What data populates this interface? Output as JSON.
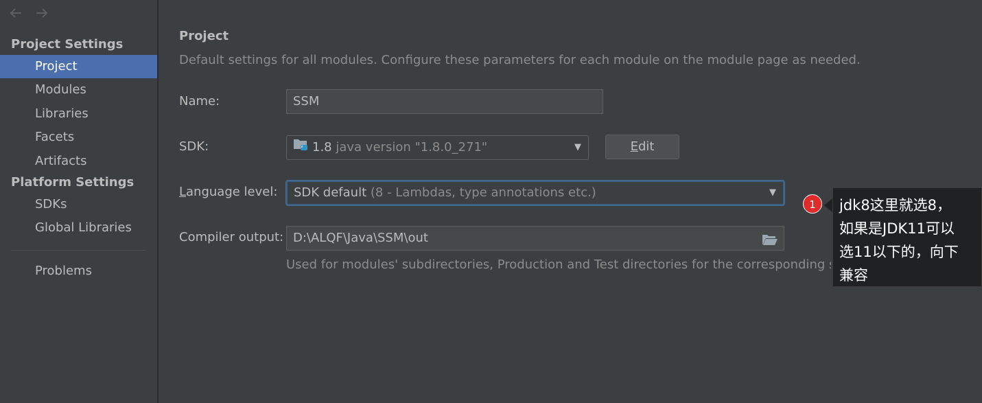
{
  "nav": {
    "back_icon": "arrow-left-icon",
    "forward_icon": "arrow-right-icon"
  },
  "sidebar": {
    "project_settings_header": "Project Settings",
    "project_items": [
      {
        "label": "Project",
        "selected": true
      },
      {
        "label": "Modules"
      },
      {
        "label": "Libraries"
      },
      {
        "label": "Facets"
      },
      {
        "label": "Artifacts"
      }
    ],
    "platform_settings_header": "Platform Settings",
    "platform_items": [
      {
        "label": "SDKs"
      },
      {
        "label": "Global Libraries"
      }
    ],
    "problems": "Problems"
  },
  "main": {
    "title": "Project",
    "description": "Default settings for all modules. Configure these parameters for each module on the module page as needed.",
    "name_label": "Name:",
    "name_value": "SSM",
    "sdk_label": "SDK:",
    "sdk_version": "1.8",
    "sdk_detail": "java version \"1.8.0_271\"",
    "edit_button_mnemonic": "E",
    "edit_button_rest": "dit",
    "language_level_mnemonic": "L",
    "language_level_rest": "anguage level:",
    "language_level_value": "SDK default",
    "language_level_detail": "(8 - Lambdas, type annotations etc.)",
    "compiler_output_label": "Compiler output:",
    "compiler_output_value": "D:\\ALQF\\Java\\SSM\\out",
    "compiler_output_hint": "Used for modules' subdirectories, Production and Test directories for the corresponding sources."
  },
  "annotation": {
    "badge_number": "1",
    "note_lines": [
      "jdk8这里就选8，",
      "如果是JDK11可以",
      "选11以下的，向下",
      "兼容"
    ]
  },
  "colors": {
    "accent": "#4b6eaf",
    "badge": "#e02b2b",
    "focus": "#3d6185"
  }
}
